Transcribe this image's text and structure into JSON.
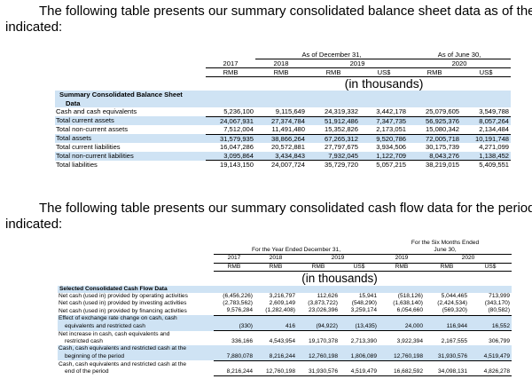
{
  "section1": {
    "intro_line1": "The following table presents our summary consolidated balance sheet data as of the dat",
    "intro_line2": "indicated:",
    "header": {
      "group_dec": "As of December 31,",
      "group_jun": "As of June 30,",
      "years": [
        "2017",
        "2018",
        "2019",
        "2020"
      ],
      "currencies": [
        "RMB",
        "RMB",
        "RMB",
        "US$",
        "RMB",
        "US$"
      ],
      "unit": "(in thousands)"
    },
    "section_title_1": "Summary Consolidated Balance Sheet",
    "section_title_2": "Data",
    "rows": [
      {
        "label": "Cash and cash equivalents",
        "values": [
          "5,236,100",
          "9,115,649",
          "24,319,332",
          "3,442,178",
          "25,079,605",
          "3,549,788"
        ]
      },
      {
        "label": "Total current assets",
        "values": [
          "24,067,931",
          "27,374,784",
          "51,912,486",
          "7,347,735",
          "56,925,376",
          "8,057,264"
        ]
      },
      {
        "label": "Total non-current assets",
        "values": [
          "7,512,004",
          "11,491,480",
          "15,352,826",
          "2,173,051",
          "15,080,342",
          "2,134,484"
        ]
      },
      {
        "label": "Total assets",
        "values": [
          "31,579,935",
          "38,866,264",
          "67,265,312",
          "9,520,786",
          "72,005,718",
          "10,191,748"
        ]
      },
      {
        "label": "Total current liabilities",
        "values": [
          "16,047,286",
          "20,572,881",
          "27,797,675",
          "3,934,506",
          "30,175,739",
          "4,271,099"
        ]
      },
      {
        "label": "Total non-current liabilities",
        "values": [
          "3,095,864",
          "3,434,843",
          "7,932,045",
          "1,122,709",
          "8,043,276",
          "1,138,452"
        ]
      },
      {
        "label": "Total liabilities",
        "values": [
          "19,143,150",
          "24,007,724",
          "35,729,720",
          "5,057,215",
          "38,219,015",
          "5,409,551"
        ]
      }
    ]
  },
  "section2": {
    "intro_line1": "The following table presents our summary consolidated cash flow data for the periods",
    "intro_line2": "indicated:",
    "header": {
      "group_year": "For the Year Ended December 31,",
      "group_six_1": "For the Six Months Ended",
      "group_six_2": "June 30,",
      "years": [
        "2017",
        "2018",
        "2019",
        "2019",
        "2020"
      ],
      "currencies": [
        "RMB",
        "RMB",
        "RMB",
        "US$",
        "RMB",
        "RMB",
        "US$"
      ],
      "unit": "(in thousands)"
    },
    "section_title": "Selected Consolidated Cash Flow Data",
    "rows": [
      {
        "label": [
          "Net cash (used in) provided by operating activities"
        ],
        "values": [
          "(6,456,226)",
          "3,216,797",
          "112,626",
          "15,941",
          "(518,126)",
          "5,044,465",
          "713,999"
        ]
      },
      {
        "label": [
          "Net cash (used in) provided by investing activities"
        ],
        "values": [
          "(2,783,562)",
          "2,609,149",
          "(3,873,722)",
          "(548,290)",
          "(1,638,140)",
          "(2,424,534)",
          "(343,170)"
        ]
      },
      {
        "label": [
          "Net cash (used in) provided by financing activities"
        ],
        "values": [
          "9,576,284",
          "(1,282,408)",
          "23,026,396",
          "3,259,174",
          "6,054,660",
          "(569,320)",
          "(80,582)"
        ]
      },
      {
        "label": [
          "Effect of exchange rate change on cash, cash",
          "equivalents and restricted cash"
        ],
        "values": [
          "(330)",
          "416",
          "(94,922)",
          "(13,435)",
          "24,000",
          "116,944",
          "16,552"
        ]
      },
      {
        "label": [
          "Net increase in cash, cash equivalents and",
          "restricted cash"
        ],
        "values": [
          "336,166",
          "4,543,954",
          "19,170,378",
          "2,713,390",
          "3,922,394",
          "2,167,555",
          "306,799"
        ]
      },
      {
        "label": [
          "Cash, cash equivalents and restricted cash at the",
          "beginning of the period"
        ],
        "values": [
          "7,880,078",
          "8,216,244",
          "12,760,198",
          "1,806,089",
          "12,760,198",
          "31,930,576",
          "4,519,479"
        ]
      },
      {
        "label": [
          "Cash, cash equivalents and restricted cash at the",
          "end of the period"
        ],
        "values": [
          "8,216,244",
          "12,760,198",
          "31,930,576",
          "4,519,479",
          "16,682,592",
          "34,098,131",
          "4,826,278"
        ]
      }
    ]
  }
}
